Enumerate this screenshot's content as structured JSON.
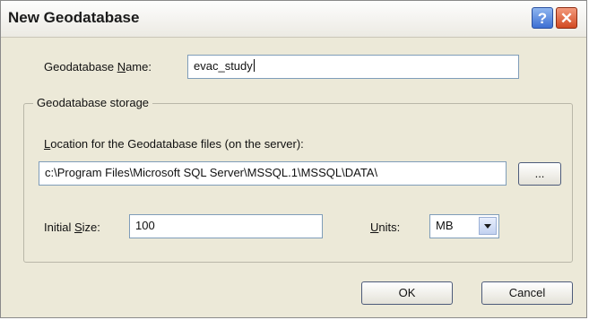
{
  "window": {
    "title": "New Geodatabase",
    "help_glyph": "?",
    "close_glyph": "✕"
  },
  "name_field": {
    "label_pre": "Geodatabase ",
    "label_mnemonic": "N",
    "label_post": "ame:",
    "value": "evac_study"
  },
  "storage": {
    "group_title": "Geodatabase storage",
    "location_label_mnemonic": "L",
    "location_label_post": "ocation for the Geodatabase files (on the server):",
    "location_value": "c:\\Program Files\\Microsoft SQL Server\\MSSQL.1\\MSSQL\\DATA\\",
    "browse_label": "...",
    "size_label_pre": "Initial ",
    "size_label_mnemonic": "S",
    "size_label_post": "ize:",
    "size_value": "100",
    "units_label_mnemonic": "U",
    "units_label_post": "nits:",
    "units_value": "MB"
  },
  "footer": {
    "ok_label": "OK",
    "cancel_label": "Cancel"
  }
}
